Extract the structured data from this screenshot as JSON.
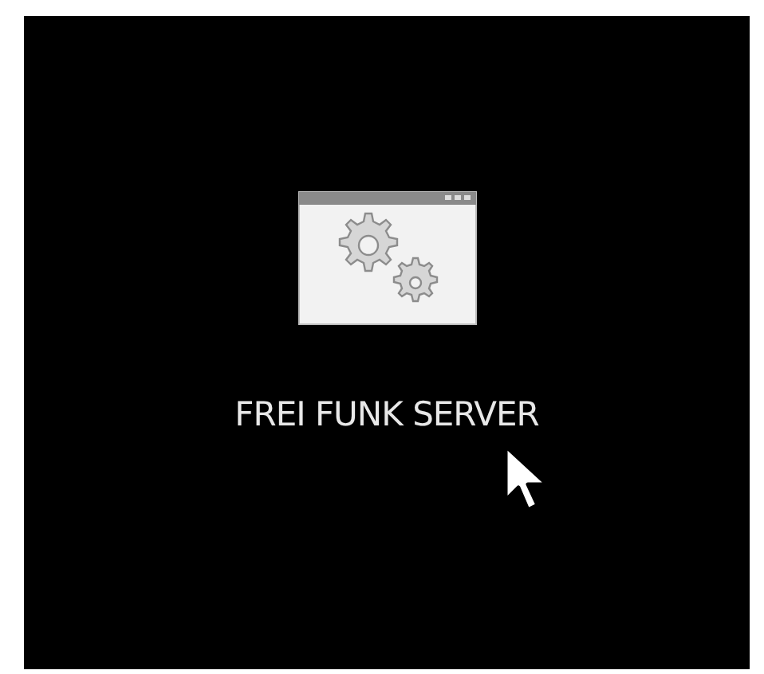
{
  "tile": {
    "label": "FREI FUNK SERVER"
  }
}
